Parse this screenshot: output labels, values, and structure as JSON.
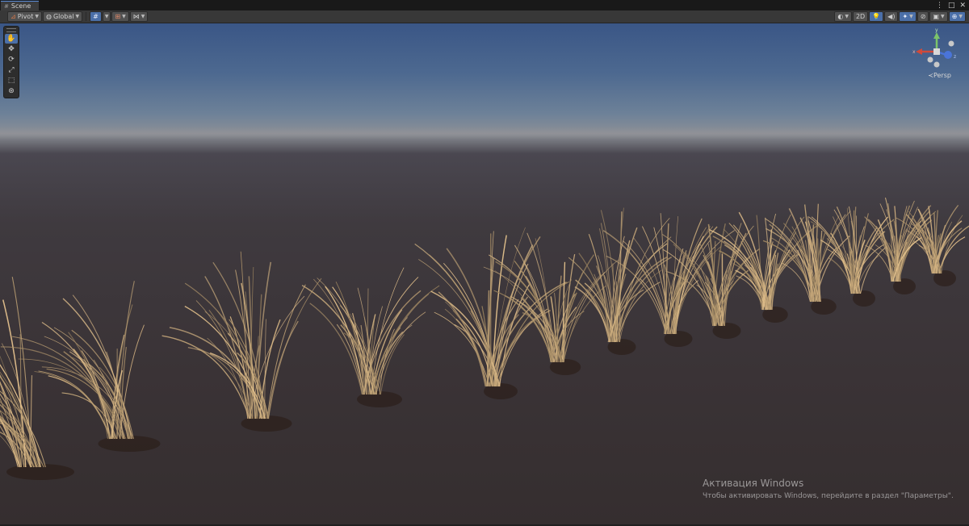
{
  "tab": {
    "label": "Scene",
    "icon": "scene-icon"
  },
  "window_controls": {
    "more": "⋮",
    "maximize": "□",
    "close": "✕"
  },
  "toolbar": {
    "pivot_label": "Pivot",
    "global_label": "Global",
    "mode_2d": "2D"
  },
  "viewport": {
    "gizmo_axes": {
      "x": "x",
      "y": "y",
      "z": "z"
    },
    "projection_label": "≺Persp"
  },
  "watermark": {
    "title": "Активация Windows",
    "subtitle": "Чтобы активировать Windows, перейдите в раздел \"Параметры\"."
  },
  "colors": {
    "accent": "#4b6fa8",
    "sky_top": "#3a5686",
    "ground": "#3a3336",
    "grass": "#c9b190"
  }
}
